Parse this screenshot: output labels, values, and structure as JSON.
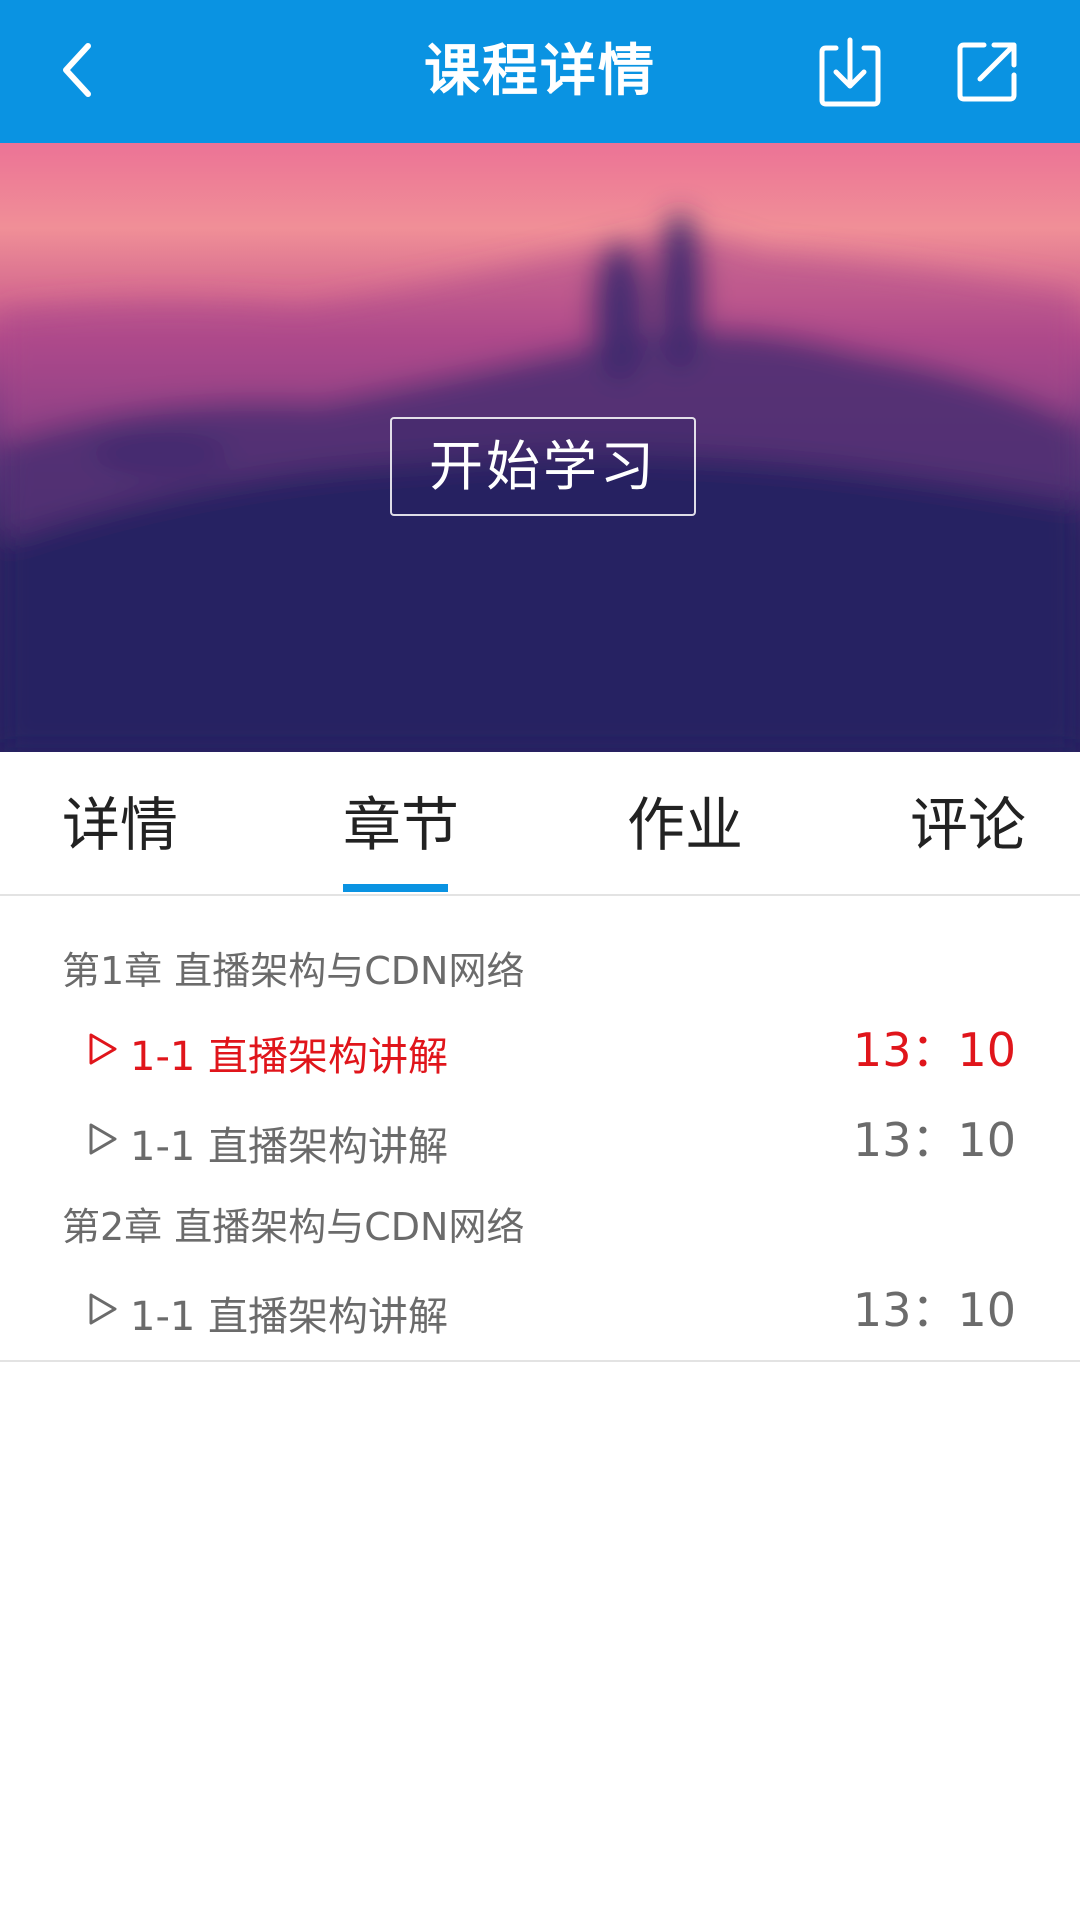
{
  "header": {
    "title": "课程详情",
    "back_icon": "chevron-left-icon",
    "download_icon": "download-icon",
    "share_icon": "share-icon",
    "bg_color": "#0a93e2"
  },
  "hero": {
    "start_label": "开始学习"
  },
  "tabs": [
    {
      "label": "详情",
      "active": false
    },
    {
      "label": "章节",
      "active": true
    },
    {
      "label": "作业",
      "active": false
    },
    {
      "label": "评论",
      "active": false
    }
  ],
  "chapters": [
    {
      "title": "第1章 直播架构与CDN网络",
      "lessons": [
        {
          "label": "1-1 直播架构讲解",
          "time": "13：10",
          "active": true
        },
        {
          "label": "1-1 直播架构讲解",
          "time": "13：10",
          "active": false
        }
      ]
    },
    {
      "title": "第2章 直播架构与CDN网络",
      "lessons": [
        {
          "label": "1-1 直播架构讲解",
          "time": "13：10",
          "active": false
        }
      ]
    }
  ],
  "colors": {
    "accent": "#0a93e2",
    "active_lesson": "#e0151b",
    "muted_text": "#6b6b6b"
  }
}
